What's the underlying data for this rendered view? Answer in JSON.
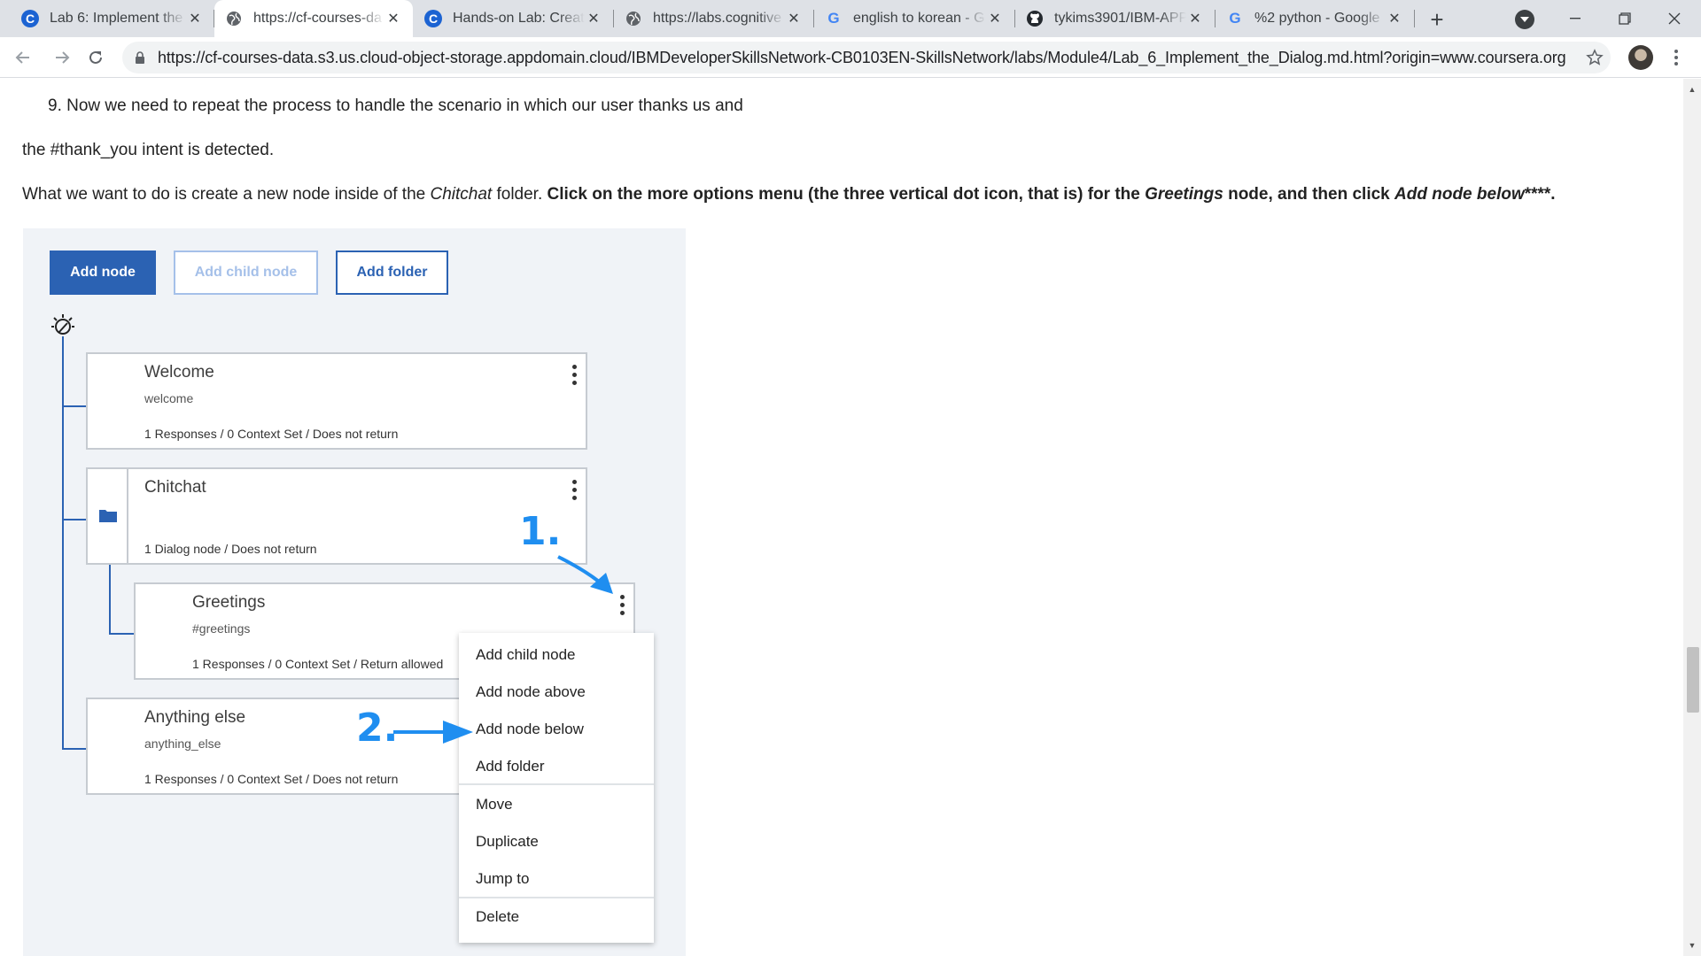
{
  "browser": {
    "tabs": [
      {
        "title": "Lab 6: Implement the",
        "icon": "coursera-icon"
      },
      {
        "title": "https://cf-courses-da",
        "icon": "globe-icon"
      },
      {
        "title": "Hands-on Lab: Creati",
        "icon": "coursera-icon"
      },
      {
        "title": "https://labs.cognitive",
        "icon": "globe-icon"
      },
      {
        "title": "english to korean - G",
        "icon": "google-icon"
      },
      {
        "title": "tykims3901/IBM-APPL",
        "icon": "github-icon"
      },
      {
        "title": "%2 python - Google",
        "icon": "google-icon"
      }
    ],
    "active_tab_index": 1,
    "url": "https://cf-courses-data.s3.us.cloud-object-storage.appdomain.cloud/IBMDeveloperSkillsNetwork-CB0103EN-SkillsNetwork/labs/Module4/Lab_6_Implement_the_Dialog.md.html?origin=www.coursera.org"
  },
  "article": {
    "step_number": "9.",
    "step_text": "Now we need to repeat the process to handle the scenario in which our user thanks us and",
    "line2": "the #thank_you intent is detected.",
    "line3_part1": "What we want to do is create a new node inside of the ",
    "line3_chitchat": "Chitchat",
    "line3_part2": " folder. ",
    "line3_bold1": "Click on the more options menu (the three vertical dot icon, that is) for the ",
    "line3_greetings": "Greetings",
    "line3_bold2": " node, and then click ",
    "line3_addbelow": "Add node below",
    "line3_end": "****."
  },
  "figure": {
    "buttons": {
      "add_node": "Add node",
      "add_child_node": "Add child node",
      "add_folder": "Add folder"
    },
    "nodes": [
      {
        "title": "Welcome",
        "condition": "welcome",
        "meta": "1 Responses / 0 Context Set / Does not return"
      },
      {
        "title": "Chitchat",
        "condition": "",
        "meta": "1 Dialog node / Does not return"
      },
      {
        "title": "Greetings",
        "condition": "#greetings",
        "meta": "1 Responses / 0 Context Set / Return allowed"
      },
      {
        "title": "Anything else",
        "condition": "anything_else",
        "meta": "1 Responses / 0 Context Set / Does not return"
      }
    ],
    "menu": {
      "items": [
        "Add child node",
        "Add node above",
        "Add node below",
        "Add folder",
        "Move",
        "Duplicate",
        "Jump to",
        "Delete"
      ]
    },
    "annotations": {
      "first": "1.",
      "second": "2."
    },
    "accent_color": "#2b62b3",
    "annotation_color": "#1f8ef0"
  }
}
